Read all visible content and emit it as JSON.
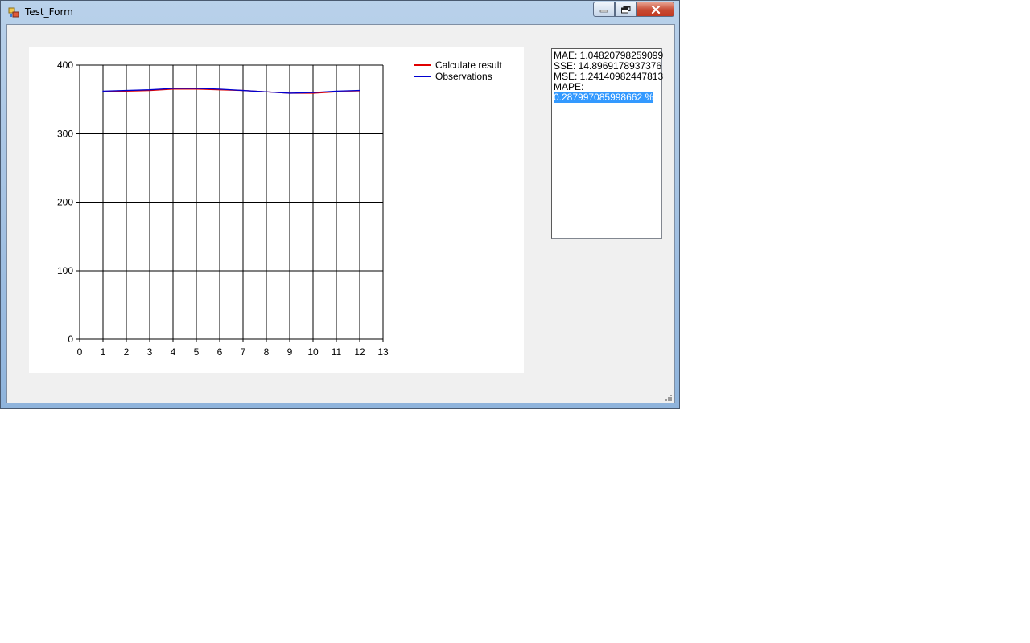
{
  "window": {
    "title": "Test_Form"
  },
  "results": {
    "mae": "MAE: 1.04820798259099",
    "sse": "SSE: 14.8969178937376",
    "mse": "MSE: 1.24140982447813",
    "mape_label": "MAPE:",
    "mape_value": "0.287997085998662 %"
  },
  "colors": {
    "calculate": "#e00000",
    "observations": "#0000d0",
    "grid": "#000000"
  },
  "chart_data": {
    "type": "line",
    "title": "",
    "xlabel": "",
    "ylabel": "",
    "xlim": [
      0,
      13
    ],
    "ylim": [
      0,
      400
    ],
    "x_ticks": [
      0,
      1,
      2,
      3,
      4,
      5,
      6,
      7,
      8,
      9,
      10,
      11,
      12,
      13
    ],
    "y_ticks": [
      0,
      100,
      200,
      300,
      400
    ],
    "grid": true,
    "legend": "top-right",
    "x": [
      1,
      2,
      3,
      4,
      5,
      6,
      7,
      8,
      9,
      10,
      11,
      12
    ],
    "series": [
      {
        "name": "Calculate result",
        "color": "#e00000",
        "values": [
          361,
          362,
          363,
          365,
          365,
          364,
          363,
          361,
          359,
          359,
          361,
          361
        ]
      },
      {
        "name": "Observations",
        "color": "#0000d0",
        "values": [
          362,
          363,
          364,
          366,
          366,
          365,
          363,
          361,
          359,
          360,
          362,
          363
        ]
      }
    ]
  }
}
